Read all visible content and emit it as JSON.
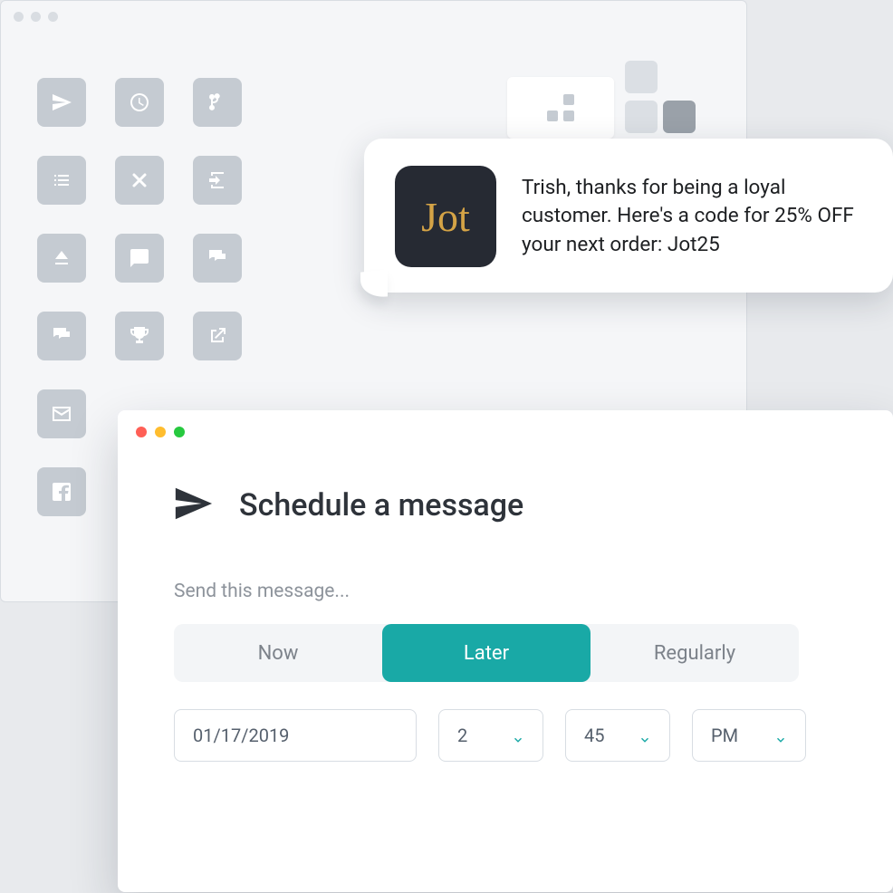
{
  "colors": {
    "accent": "#19a9a6",
    "icon_tile": "#c5cbd2",
    "brand_bg": "#262a33",
    "brand_fg": "#d4a346"
  },
  "icon_grid": [
    "send-icon",
    "clock-icon",
    "branch-icon",
    "list-icon",
    "close-icon",
    "exit-icon",
    "eject-icon",
    "chat-icon",
    "chat-bubbles-icon",
    "chat-alt-icon",
    "trophy-icon",
    "external-link-icon",
    "mail-icon",
    "",
    "",
    "facebook-icon",
    "",
    ""
  ],
  "notification": {
    "brand_label": "Jot",
    "message": "Trish, thanks for being a loyal customer. Here's a code for 25% OFF your next order: Jot25"
  },
  "modal": {
    "title": "Schedule a message",
    "prompt": "Send this message...",
    "tabs": {
      "now": "Now",
      "later": "Later",
      "regularly": "Regularly",
      "active": "later"
    },
    "date": "01/17/2019",
    "hour": "2",
    "minute": "45",
    "ampm": "PM"
  }
}
